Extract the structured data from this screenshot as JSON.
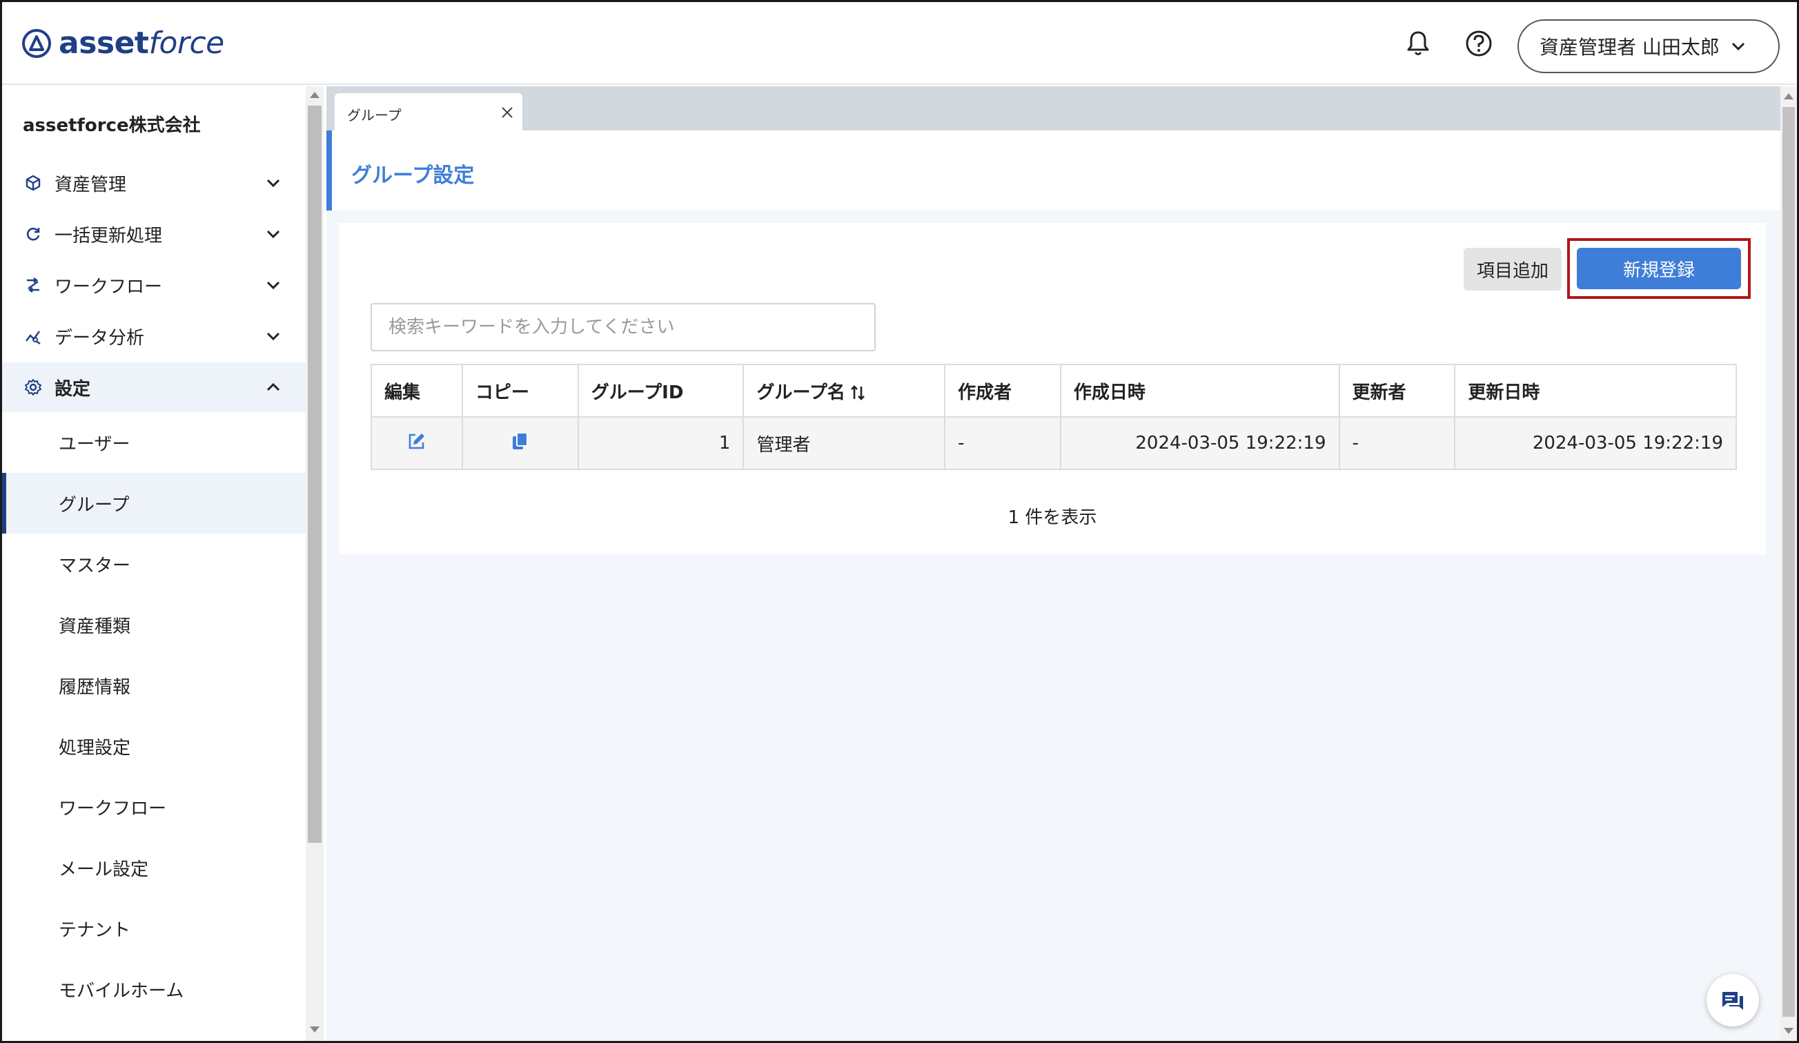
{
  "app": {
    "logo_bold": "asset",
    "logo_light": "force",
    "user_label": "資産管理者 山田太郎"
  },
  "sidebar": {
    "company": "assetforce株式会社",
    "items": [
      {
        "label": "資産管理",
        "icon": "cube-icon"
      },
      {
        "label": "一括更新処理",
        "icon": "refresh-icon"
      },
      {
        "label": "ワークフロー",
        "icon": "workflow-icon"
      },
      {
        "label": "データ分析",
        "icon": "analytics-icon"
      },
      {
        "label": "設定",
        "icon": "gear-icon"
      }
    ],
    "sub_items": [
      {
        "label": "ユーザー"
      },
      {
        "label": "グループ"
      },
      {
        "label": "マスター"
      },
      {
        "label": "資産種類"
      },
      {
        "label": "履歴情報"
      },
      {
        "label": "処理設定"
      },
      {
        "label": "ワークフロー"
      },
      {
        "label": "メール設定"
      },
      {
        "label": "テナント"
      },
      {
        "label": "モバイルホーム"
      }
    ]
  },
  "tab": {
    "label": "グループ"
  },
  "page": {
    "title": "グループ設定",
    "add_item_label": "項目追加",
    "new_label": "新規登録",
    "search_placeholder": "検索キーワードを入力してください",
    "count_text": "1 件を表示"
  },
  "table": {
    "headers": [
      "編集",
      "コピー",
      "グループID",
      "グループ名",
      "作成者",
      "作成日時",
      "更新者",
      "更新日時"
    ],
    "rows": [
      {
        "id": "1",
        "name": "管理者",
        "created_by": "-",
        "created_at": "2024-03-05 19:22:19",
        "updated_by": "-",
        "updated_at": "2024-03-05 19:22:19"
      }
    ]
  },
  "colors": {
    "accent": "#3f7ed8",
    "brand": "#1f3f86",
    "highlight": "#b0151a"
  }
}
